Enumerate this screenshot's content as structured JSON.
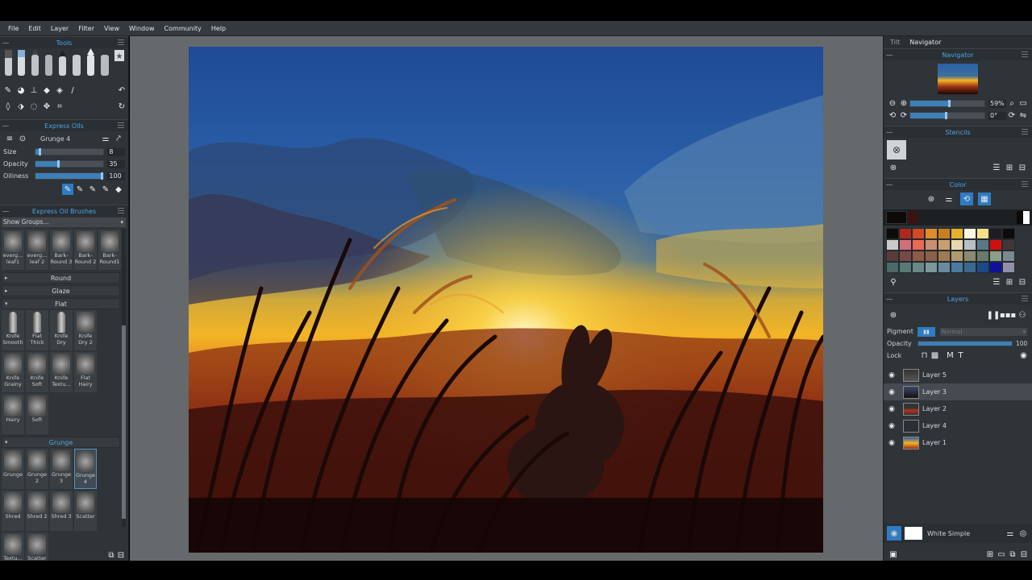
{
  "menu": [
    "File",
    "Edit",
    "Layer",
    "Filter",
    "View",
    "Window",
    "Community",
    "Help"
  ],
  "left": {
    "tools_title": "Tools",
    "express_title": "Express Oils",
    "brush_name": "Grunge 4",
    "sliders": [
      {
        "label": "Size",
        "value": "8",
        "fraction": 0.08
      },
      {
        "label": "Opacity",
        "value": "35",
        "fraction": 0.35
      },
      {
        "label": "Oiliness",
        "value": "100",
        "fraction": 1.0
      }
    ],
    "brushes_title": "Express Oil Brushes",
    "groups_select": "Show Groups...",
    "top_brushes": [
      {
        "label": "everg... leaf1"
      },
      {
        "label": "everg... leaf 2"
      },
      {
        "label": "Bark-Round 3"
      },
      {
        "label": "Bark-Round 2"
      },
      {
        "label": "Bark-Round1"
      }
    ],
    "group_round": "Round",
    "group_glaze": "Glaze",
    "group_flat": "Flat",
    "flat_brushes": [
      {
        "label": "Knife Smooth"
      },
      {
        "label": "Flat Thick"
      },
      {
        "label": "Knife Dry"
      },
      {
        "label": "Knife Dry 2"
      },
      {
        "label": "Knife Grainy"
      },
      {
        "label": "Knife Soft"
      },
      {
        "label": "Knife Textu..."
      },
      {
        "label": "Flat Hairy"
      },
      {
        "label": "Hairy"
      },
      {
        "label": "Soft"
      }
    ],
    "group_grunge": "Grunge",
    "grunge_brushes": [
      {
        "label": "Grunge"
      },
      {
        "label": "Grunge 2"
      },
      {
        "label": "Grunge 3"
      },
      {
        "label": "Grunge 4"
      },
      {
        "label": "Shred"
      },
      {
        "label": "Shred 2"
      },
      {
        "label": "Shred 3"
      },
      {
        "label": "Scatter"
      },
      {
        "label": "Textu..."
      },
      {
        "label": "Scatter 2"
      }
    ]
  },
  "right": {
    "tabs": [
      "Tilt",
      "Navigator"
    ],
    "navigator_title": "Navigator",
    "zoom": "59%",
    "rotation": "0°",
    "stencils_title": "Stencils",
    "color_title": "Color",
    "layers_title": "Layers",
    "pigment_label": "Pigment",
    "blend_mode": "Normal",
    "opacity_label": "Opacity",
    "opacity_value": "100",
    "lock_label": "Lock",
    "layers": [
      "Layer 5",
      "Layer 3",
      "Layer 2",
      "Layer 4",
      "Layer 1"
    ],
    "selected_layer": "Layer 3",
    "paper": "White Simple",
    "recent_colors": [
      "#0d0a0a",
      "#3b1212"
    ],
    "palette": [
      [
        "#0d0b0b",
        "#b0281f",
        "#d04a22",
        "#e08a2a",
        "#c8801e",
        "#e6b02a",
        "#fbf6e4",
        "#f5e08a",
        "#201a24",
        "#0d0b0b"
      ],
      [
        "#c9c9c9",
        "#d0707a",
        "#e86a55",
        "#c89070",
        "#c8a070",
        "#e6d6b0",
        "#b8c0c4",
        "#5a7888",
        "#d01010",
        "#403838"
      ],
      [
        "#5a3a3a",
        "#784848",
        "#905a48",
        "#8a6048",
        "#a07a50",
        "#b09a70",
        "#8a8a70",
        "#6a7a6a",
        "#8aa08a",
        "#7a8890"
      ],
      [
        "#4a6a6a",
        "#5a7878",
        "#6a8888",
        "#7a9898",
        "#6a8aa0",
        "#4a7aa0",
        "#3a6a8a",
        "#1a4a8a",
        "#1010a0",
        "#9090a8"
      ]
    ]
  }
}
